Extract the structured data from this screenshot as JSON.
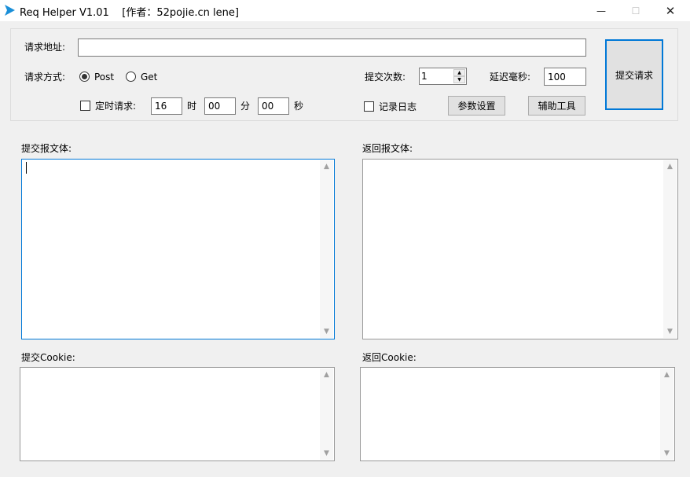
{
  "window": {
    "title": "Req Helper V1.01    [作者：52pojie.cn lene]",
    "min_glyph": "—",
    "max_glyph": "☐",
    "close_glyph": "✕"
  },
  "form": {
    "url_label": "请求地址:",
    "url_value": "",
    "method_label": "请求方式:",
    "method_options": [
      "Post",
      "Get"
    ],
    "method_selected": "Post",
    "submit_count_label": "提交次数:",
    "submit_count_value": "1",
    "delay_label": "延迟毫秒:",
    "delay_value": "100",
    "timer_label": "定时请求:",
    "timer_checked": false,
    "hour_value": "16",
    "hour_unit": "时",
    "minute_value": "00",
    "minute_unit": "分",
    "second_value": "00",
    "second_unit": "秒",
    "log_label": "记录日志",
    "log_checked": false,
    "params_button": "参数设置",
    "tools_button": "辅助工具",
    "submit_button": "提交请求"
  },
  "panels": {
    "request_body_label": "提交报文体:",
    "response_body_label": "返回报文体:",
    "request_cookie_label": "提交Cookie:",
    "response_cookie_label": "返回Cookie:"
  },
  "icons": {
    "app": "play-triangle-icon",
    "spinner_up": "spin-up-icon",
    "spinner_down": "spin-down-icon",
    "scroll_up": "scroll-up-arrow-icon",
    "scroll_down": "scroll-down-arrow-icon"
  },
  "colors": {
    "app_icon": "#1a8fd8",
    "focus_border": "#0078d7"
  }
}
